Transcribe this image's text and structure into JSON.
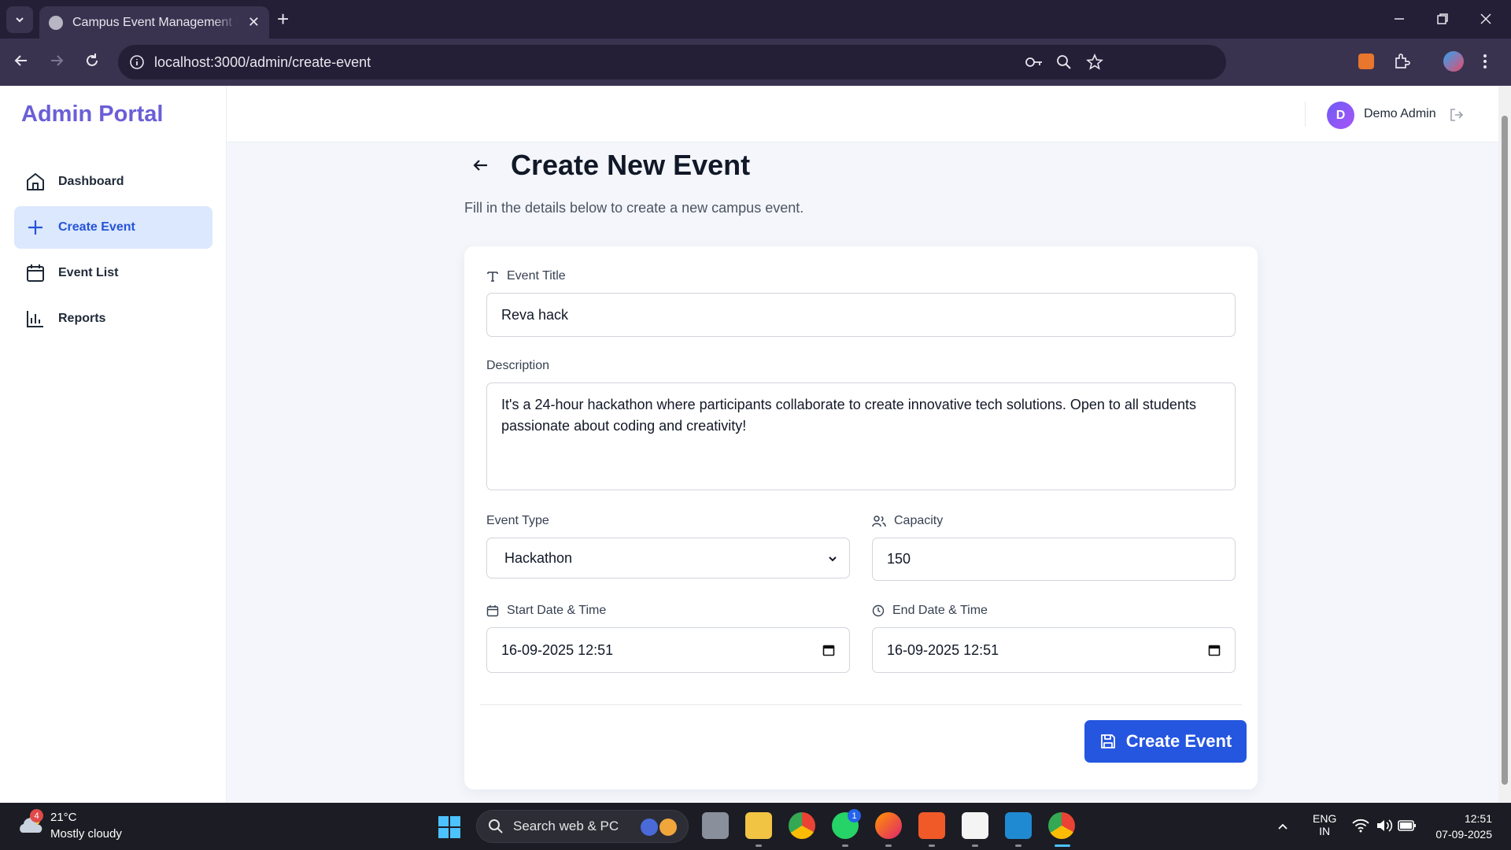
{
  "browser": {
    "tab_title": "Campus Event Management Platform",
    "url": "localhost:3000/admin/create-event"
  },
  "sidebar": {
    "brand": "Admin Portal",
    "items": [
      {
        "label": "Dashboard",
        "icon": "home-icon",
        "active": false
      },
      {
        "label": "Create Event",
        "icon": "plus-icon",
        "active": true
      },
      {
        "label": "Event List",
        "icon": "calendar-icon",
        "active": false
      },
      {
        "label": "Reports",
        "icon": "bar-chart-icon",
        "active": false
      }
    ]
  },
  "header": {
    "avatar_initial": "D",
    "user_name": "Demo Admin"
  },
  "main": {
    "title": "Create New Event",
    "subtitle": "Fill in the details below to create a new campus event."
  },
  "form": {
    "event_title": {
      "label": "Event Title",
      "value": "Reva hack"
    },
    "description": {
      "label": "Description",
      "value": "It's a 24-hour hackathon where participants collaborate to create innovative tech solutions. Open to all students passionate about coding and creativity!"
    },
    "event_type": {
      "label": "Event Type",
      "value": "Hackathon"
    },
    "capacity": {
      "label": "Capacity",
      "value": "150"
    },
    "start": {
      "label": "Start Date & Time",
      "value": "16-09-2025 12:51"
    },
    "end": {
      "label": "End Date & Time",
      "value": "16-09-2025 12:51"
    },
    "submit_label": "Create Event"
  },
  "taskbar": {
    "weather_temp": "21°C",
    "weather_desc": "Mostly cloudy",
    "weather_badge": "4",
    "search_placeholder": "Search web & PC",
    "whatsapp_badge": "1",
    "lang_top": "ENG",
    "lang_bottom": "IN",
    "time": "12:51",
    "date": "07-09-2025"
  },
  "colors": {
    "brand": "#6a5fd6",
    "primary": "#2556e0",
    "active_nav_bg": "#dbe8fd"
  }
}
